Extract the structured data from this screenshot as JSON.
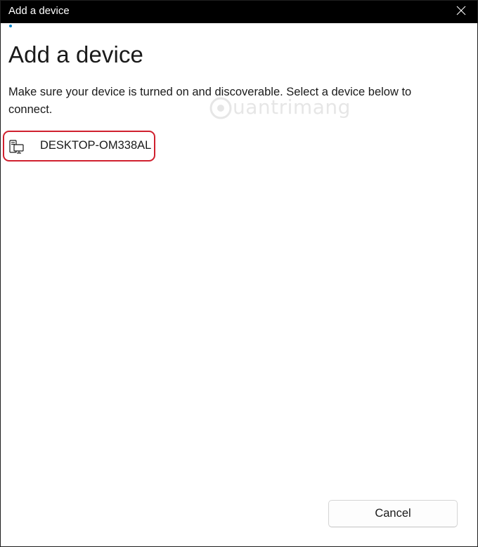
{
  "window": {
    "title": "Add a device"
  },
  "page": {
    "heading": "Add a device",
    "description": "Make sure your device is turned on and discoverable. Select a device below to connect."
  },
  "devices": [
    {
      "name": "DESKTOP-OM338AL",
      "icon": "desktop-device-icon"
    }
  ],
  "footer": {
    "cancel_label": "Cancel"
  },
  "watermark": {
    "text": "uantrimang",
    "logo": "quantrimang-logo"
  },
  "colors": {
    "titlebar": "#000000",
    "accent": "#0a84c8",
    "highlight": "#d0202e"
  }
}
